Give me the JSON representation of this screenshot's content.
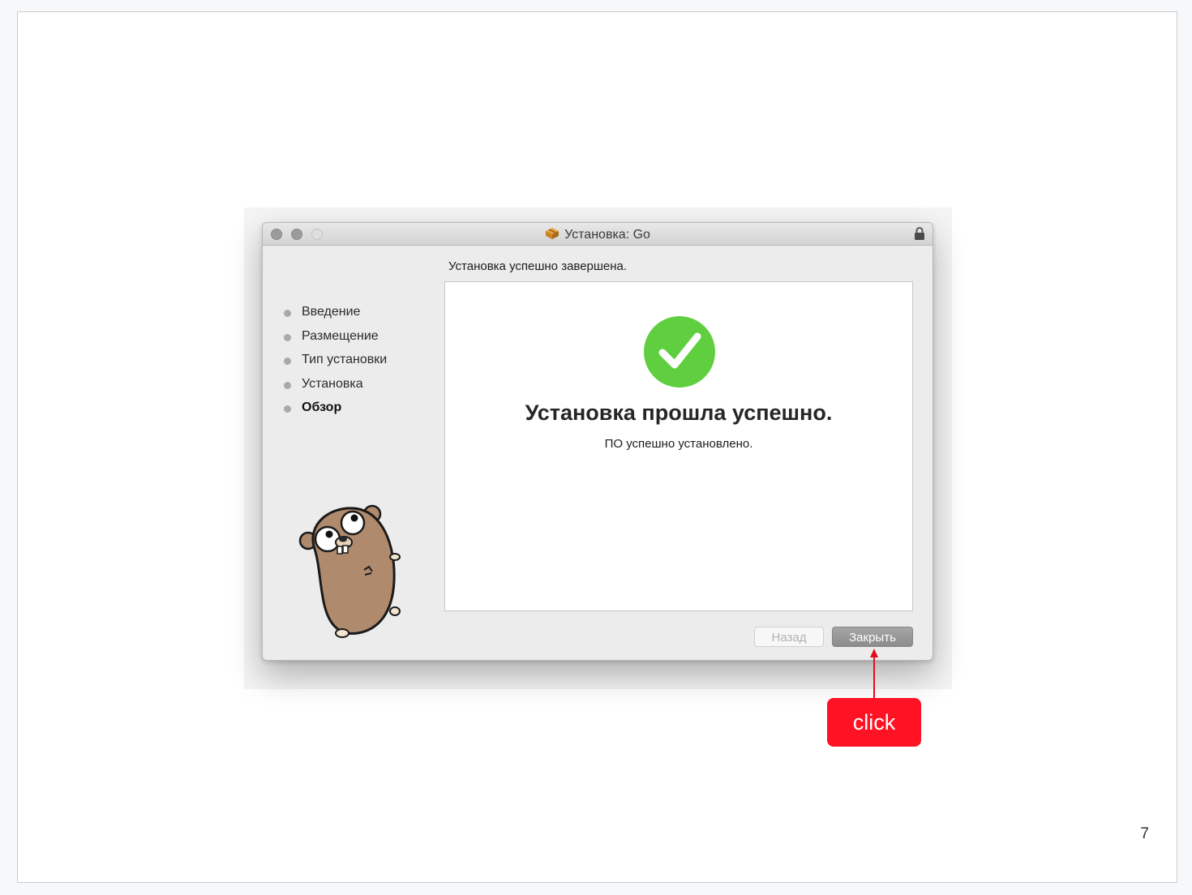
{
  "window": {
    "title": "Установка: Go",
    "header": "Установка успешно завершена."
  },
  "sidebar": {
    "steps": [
      {
        "label": "Введение",
        "active": false
      },
      {
        "label": "Размещение",
        "active": false
      },
      {
        "label": "Тип установки",
        "active": false
      },
      {
        "label": "Установка",
        "active": false
      },
      {
        "label": "Обзор",
        "active": true
      }
    ]
  },
  "main": {
    "title": "Установка прошла успешно.",
    "subtitle": "ПО успешно установлено."
  },
  "buttons": {
    "back": "Назад",
    "close": "Закрыть"
  },
  "annotation": {
    "label": "click",
    "color": "#ff1223"
  },
  "page_number": "7",
  "icons": [
    "package-icon",
    "lock-icon",
    "checkmark-icon",
    "gopher-mascot"
  ]
}
